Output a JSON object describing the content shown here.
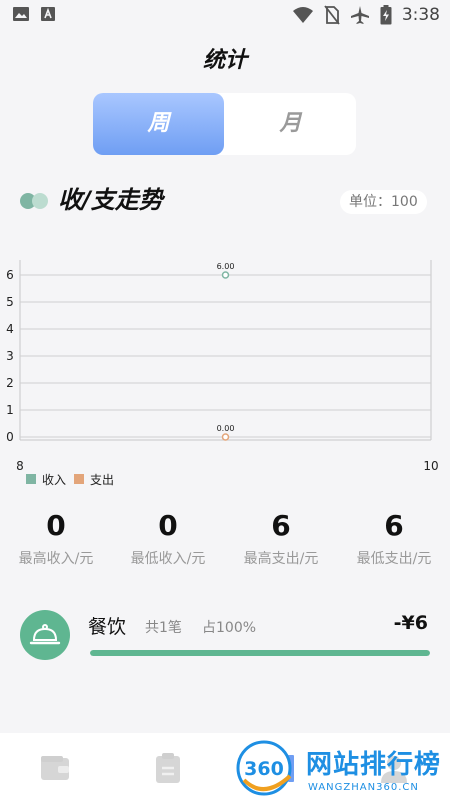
{
  "status_bar": {
    "time": "3:38",
    "left_icons": [
      "image-icon",
      "a-badge-icon"
    ],
    "right_icons": [
      "wifi-icon",
      "no-sim-icon",
      "airplane-icon",
      "battery-charging-icon"
    ]
  },
  "header": {
    "title": "统计"
  },
  "period_toggle": {
    "week_label": "周",
    "month_label": "月",
    "selected": "week"
  },
  "trend": {
    "title": "收/支走势",
    "unit_label": "单位：100"
  },
  "chart_data": {
    "type": "line",
    "x": [
      9
    ],
    "xlim": [
      8,
      10
    ],
    "x_tick_labels": [
      "8",
      "10"
    ],
    "ylim": [
      0,
      6
    ],
    "y_ticks": [
      0,
      1,
      2,
      3,
      4,
      5,
      6
    ],
    "grid": true,
    "legend_position": "bottom-left",
    "series": [
      {
        "name": "收入",
        "color": "#7fb5a3",
        "values": [
          6
        ],
        "data_labels": [
          "6.00"
        ]
      },
      {
        "name": "支出",
        "color": "#e3a57a",
        "values": [
          0
        ],
        "data_labels": [
          "0.00"
        ]
      }
    ]
  },
  "stats": [
    {
      "value": "0",
      "label": "最高收入/元"
    },
    {
      "value": "0",
      "label": "最低收入/元"
    },
    {
      "value": "6",
      "label": "最高支出/元"
    },
    {
      "value": "6",
      "label": "最低支出/元"
    }
  ],
  "categories": [
    {
      "name": "餐饮",
      "count": "共1笔",
      "percent_label": "占100%",
      "percent": 1.0,
      "amount": "-¥6",
      "color": "#5fb691"
    }
  ],
  "bottom_nav": {
    "items": [
      "wallet-icon",
      "clipboard-icon",
      "chart-icon",
      "profile-icon"
    ]
  },
  "watermark": {
    "badge": "360",
    "text": "网站排行榜",
    "subtext": "WANGZHAN360.CN"
  }
}
